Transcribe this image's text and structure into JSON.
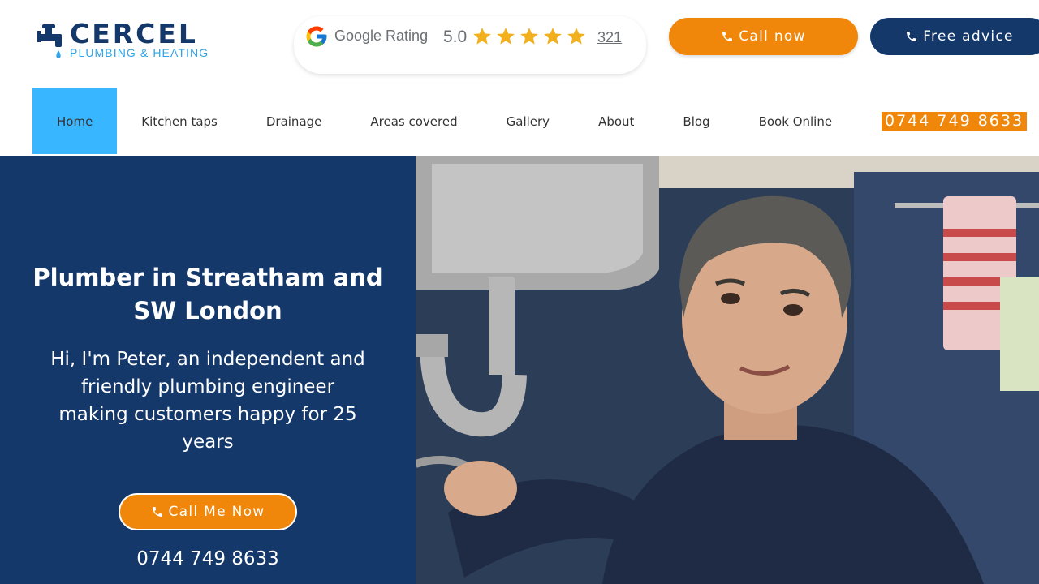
{
  "brand": {
    "name": "CERCEL",
    "tagline": "PLUMBING & HEATING",
    "colors": {
      "navy": "#15386b",
      "orange": "#f0870b",
      "sky": "#38b6ff",
      "light_blue": "#2fa4e7"
    }
  },
  "rating": {
    "provider_label": "Google Rating",
    "score": "5.0",
    "stars": 5,
    "review_count": "321"
  },
  "header_buttons": {
    "call_label": "Call now",
    "advice_label": "Free advice"
  },
  "nav": {
    "items": [
      {
        "label": "Home",
        "active": true
      },
      {
        "label": "Kitchen taps"
      },
      {
        "label": "Drainage"
      },
      {
        "label": "Areas covered"
      },
      {
        "label": "Gallery"
      },
      {
        "label": "About"
      },
      {
        "label": "Blog"
      },
      {
        "label": "Book Online"
      }
    ],
    "phone": "0744 749 8633"
  },
  "hero": {
    "title": "Plumber in Streatham and SW London",
    "text": "Hi, I'm Peter, an independent and friendly plumbing engineer making customers happy for 25 years",
    "cta_label": "Call Me Now",
    "phone": "0744 749 8633",
    "photo_icon": "plumber-photo"
  }
}
